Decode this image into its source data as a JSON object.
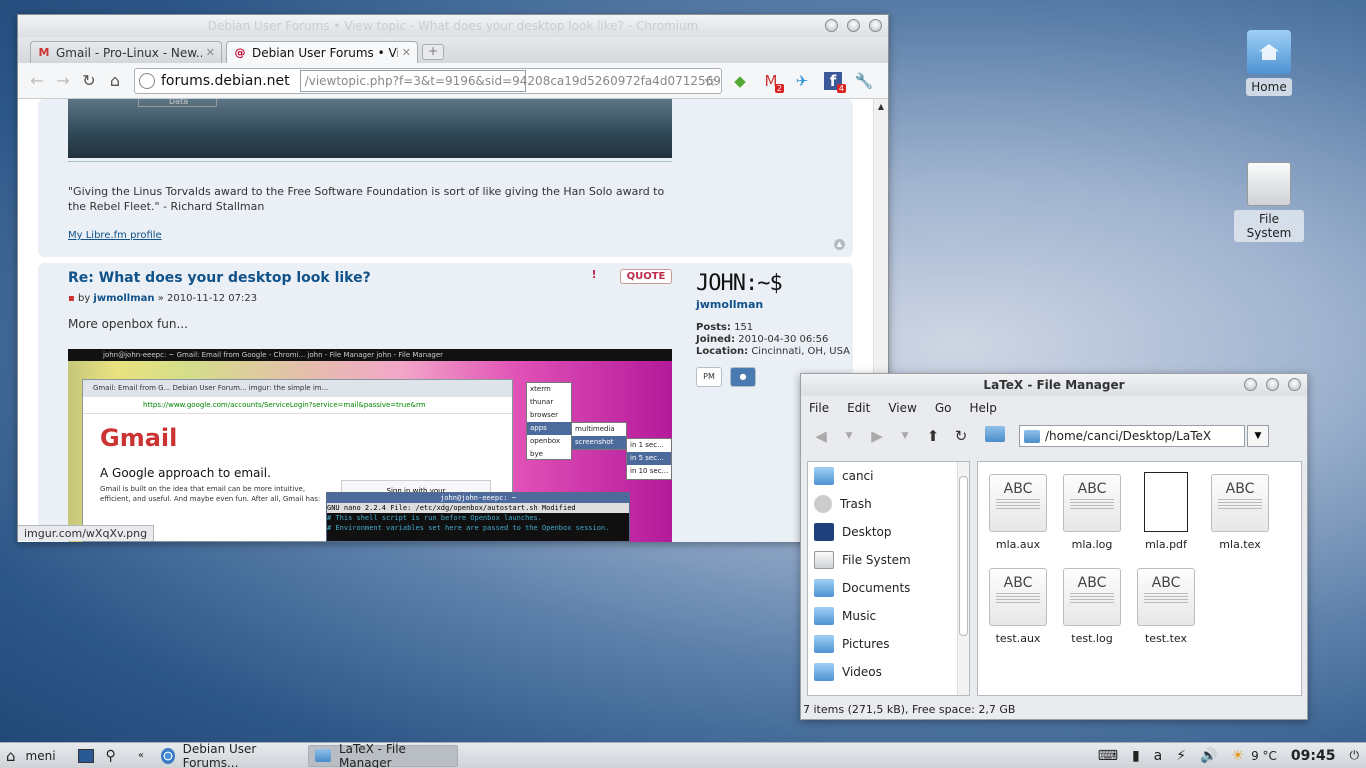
{
  "desktop": {
    "icons": [
      {
        "label": "Home"
      },
      {
        "label": "File System"
      }
    ]
  },
  "browser": {
    "title": "Debian User Forums • View topic - What does your desktop look like? - Chromium",
    "tabs": [
      {
        "icon": "M",
        "label": "Gmail - Pro-Linux - New..."
      },
      {
        "icon": "@",
        "label": "Debian User Forums • Vi..."
      }
    ],
    "url_host": "forums.debian.net",
    "url_path": "/viewtopic.php?f=3&t=9196&sid=94208ca19d5260972fa4d0712569t",
    "ext_badges": [
      "2",
      "4"
    ],
    "status_url": "imgur.com/wXqXv.png",
    "page": {
      "img_label": "Data",
      "signature": "\"Giving the Linus Torvalds award to the Free Software Foundation is sort of like giving the Han Solo award to the Rebel Fleet.\" - Richard Stallman",
      "profile_link": "My Libre.fm profile",
      "post_title": "Re: What does your desktop look like?",
      "post_by": "by",
      "post_author": "jwmollman",
      "post_date": "» 2010-11-12 07:23",
      "post_text": "More openbox fun...",
      "quote_label": "QUOTE",
      "brand": "JOHN:~$",
      "username": "jwmollman",
      "posts_label": "Posts:",
      "posts": "151",
      "joined_label": "Joined:",
      "joined": "2010-04-30 06:56",
      "location_label": "Location:",
      "location": "Cincinnati, OH, USA",
      "pm_label": "PM",
      "shot": {
        "bar_text": "john@john-eeepc: ~        Gmail: Email from Google - Chromi...        john - File Manager        john - File Manager",
        "tabs_text": "Gmail: Email from G...   Debian User Forum...   imgur: the simple im...",
        "url": "https://www.google.com/accounts/ServiceLogin?service=mail&passive=true&rm",
        "gmail": "Gmail",
        "heading": "A Google approach to email.",
        "body": "Gmail is built on the idea that email can be more intuitive, efficient, and useful. And maybe even fun. After all, Gmail has:",
        "sign": "Sign in with your",
        "menu": [
          "xterm",
          "thunar",
          "browser",
          "apps",
          "openbox",
          "bye"
        ],
        "submenu": [
          "multimedia",
          "screenshot"
        ],
        "subsub": [
          "in 1 sec...",
          "in 5 sec...",
          "in 10 sec..."
        ],
        "term_title": "john@john-eeepc: ~",
        "term_line1": " GNU nano 2.2.4        File: /etc/xdg/openbox/autostart.sh        Modified",
        "term_line2": "# This shell script is run before Openbox launches.",
        "term_line3": "# Environment variables set here are passed to the Openbox session."
      }
    }
  },
  "filemanager": {
    "title": "LaTeX - File Manager",
    "menu": [
      "File",
      "Edit",
      "View",
      "Go",
      "Help"
    ],
    "path": "/home/canci/Desktop/LaTeX",
    "places": [
      "canci",
      "Trash",
      "Desktop",
      "File System",
      "Documents",
      "Music",
      "Pictures",
      "Videos"
    ],
    "files": [
      "mla.aux",
      "mla.log",
      "mla.pdf",
      "mla.tex",
      "test.aux",
      "test.log",
      "test.tex"
    ],
    "thumb_text": "ABC",
    "status": "7 items (271,5 kB), Free space: 2,7 GB"
  },
  "taskbar": {
    "menu_label": "meni",
    "tasks": [
      "Debian User Forums...",
      "LaTeX - File Manager"
    ],
    "weather": "9 °C",
    "clock": "09:45"
  }
}
